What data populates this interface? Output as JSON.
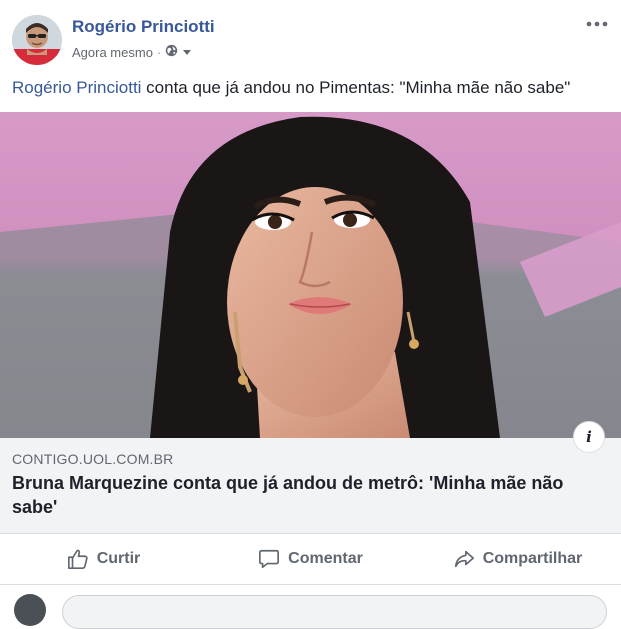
{
  "post": {
    "author": "Rogério Princiotti",
    "timestamp": "Agora mesmo",
    "separator": "·",
    "privacy_icon": "globe-icon",
    "audience_menu_icon": "caret-down-icon",
    "more_icon": "more-options-icon",
    "text_link": "Rogério Princiotti",
    "text_rest": " conta que já andou no Pimentas: \"Minha mãe não sabe\""
  },
  "link_preview": {
    "domain": "CONTIGO.UOL.COM.BR",
    "headline": "Bruna Marquezine conta que já andou de metrô: 'Minha mãe não sabe'",
    "info_icon": "info-icon",
    "info_label": "i"
  },
  "actions": {
    "like_label": "Curtir",
    "comment_label": "Comentar",
    "share_label": "Compartilhar"
  },
  "colors": {
    "link": "#385898",
    "text": "#1d2129",
    "muted": "#606770",
    "preview_bg": "#f2f3f5"
  }
}
